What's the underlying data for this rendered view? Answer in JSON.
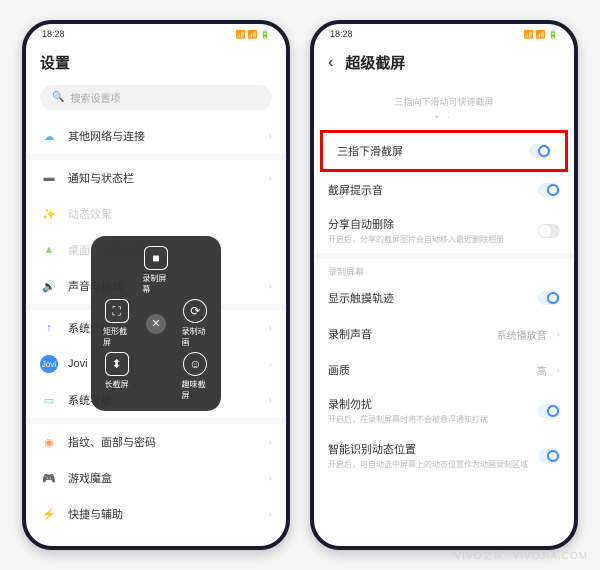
{
  "status": {
    "time": "18:28",
    "icons": "📶 📶 🔋"
  },
  "left": {
    "title": "设置",
    "search_placeholder": "搜索设置项",
    "items": [
      {
        "label": "其他网络与连接",
        "color": "#4db8ff",
        "glyph": "☁"
      },
      {
        "label": "通知与状态栏",
        "color": "#6a6a6a",
        "glyph": "▬",
        "dim": false
      },
      {
        "label": "动态效果",
        "color": "#ff7a4d",
        "glyph": "✨",
        "dim": true
      },
      {
        "label": "桌面、锁屏与壁纸",
        "color": "#8bd46e",
        "glyph": "▲",
        "dim": true
      },
      {
        "label": "声音与振动",
        "color": "#ff5a5a",
        "glyph": "🔊"
      },
      {
        "label": "系统升级",
        "color": "#4d7aff",
        "glyph": "↑"
      },
      {
        "label": "Jovi",
        "color": "#3b8cff",
        "glyph": "J",
        "text": "Jovi"
      },
      {
        "label": "系统导航",
        "color": "#4dd4a8",
        "glyph": "▭"
      },
      {
        "label": "指纹、面部与密码",
        "color": "#ff9a4d",
        "glyph": "◉"
      },
      {
        "label": "游戏魔盒",
        "color": "#8a4dff",
        "glyph": "🎮"
      },
      {
        "label": "快捷与辅助",
        "color": "#ff7a4d",
        "glyph": "⚡"
      }
    ],
    "overlay": {
      "record": "录制屏幕",
      "rect": "矩形截屏",
      "anim": "录制动画",
      "long": "长截屏",
      "fun": "趣味截屏"
    }
  },
  "right": {
    "title": "超级截屏",
    "hint": "三指向下滑动可快速截屏",
    "rows": {
      "three_finger": "三指下滑截屏",
      "sound": "截屏提示音",
      "share_del": "分享自动删除",
      "share_del_sub": "开启后，分享的截屏图片会自动移入最近删除相册",
      "section_record": "录制屏幕",
      "show_touch": "显示触摸轨迹",
      "record_audio": "录制声音",
      "record_audio_val": "系统播放音",
      "quality": "画质",
      "quality_val": "高",
      "dnd": "录制勿扰",
      "dnd_sub": "开启后，在录制屏幕时将不会被悬浮通知打扰",
      "smart": "智能识别动态位置",
      "smart_sub": "开启后，可自动选中屏幕上的动态位置作为动画录制区域"
    }
  },
  "watermark": "VIVO之家\n-VIVOJIA.COM"
}
